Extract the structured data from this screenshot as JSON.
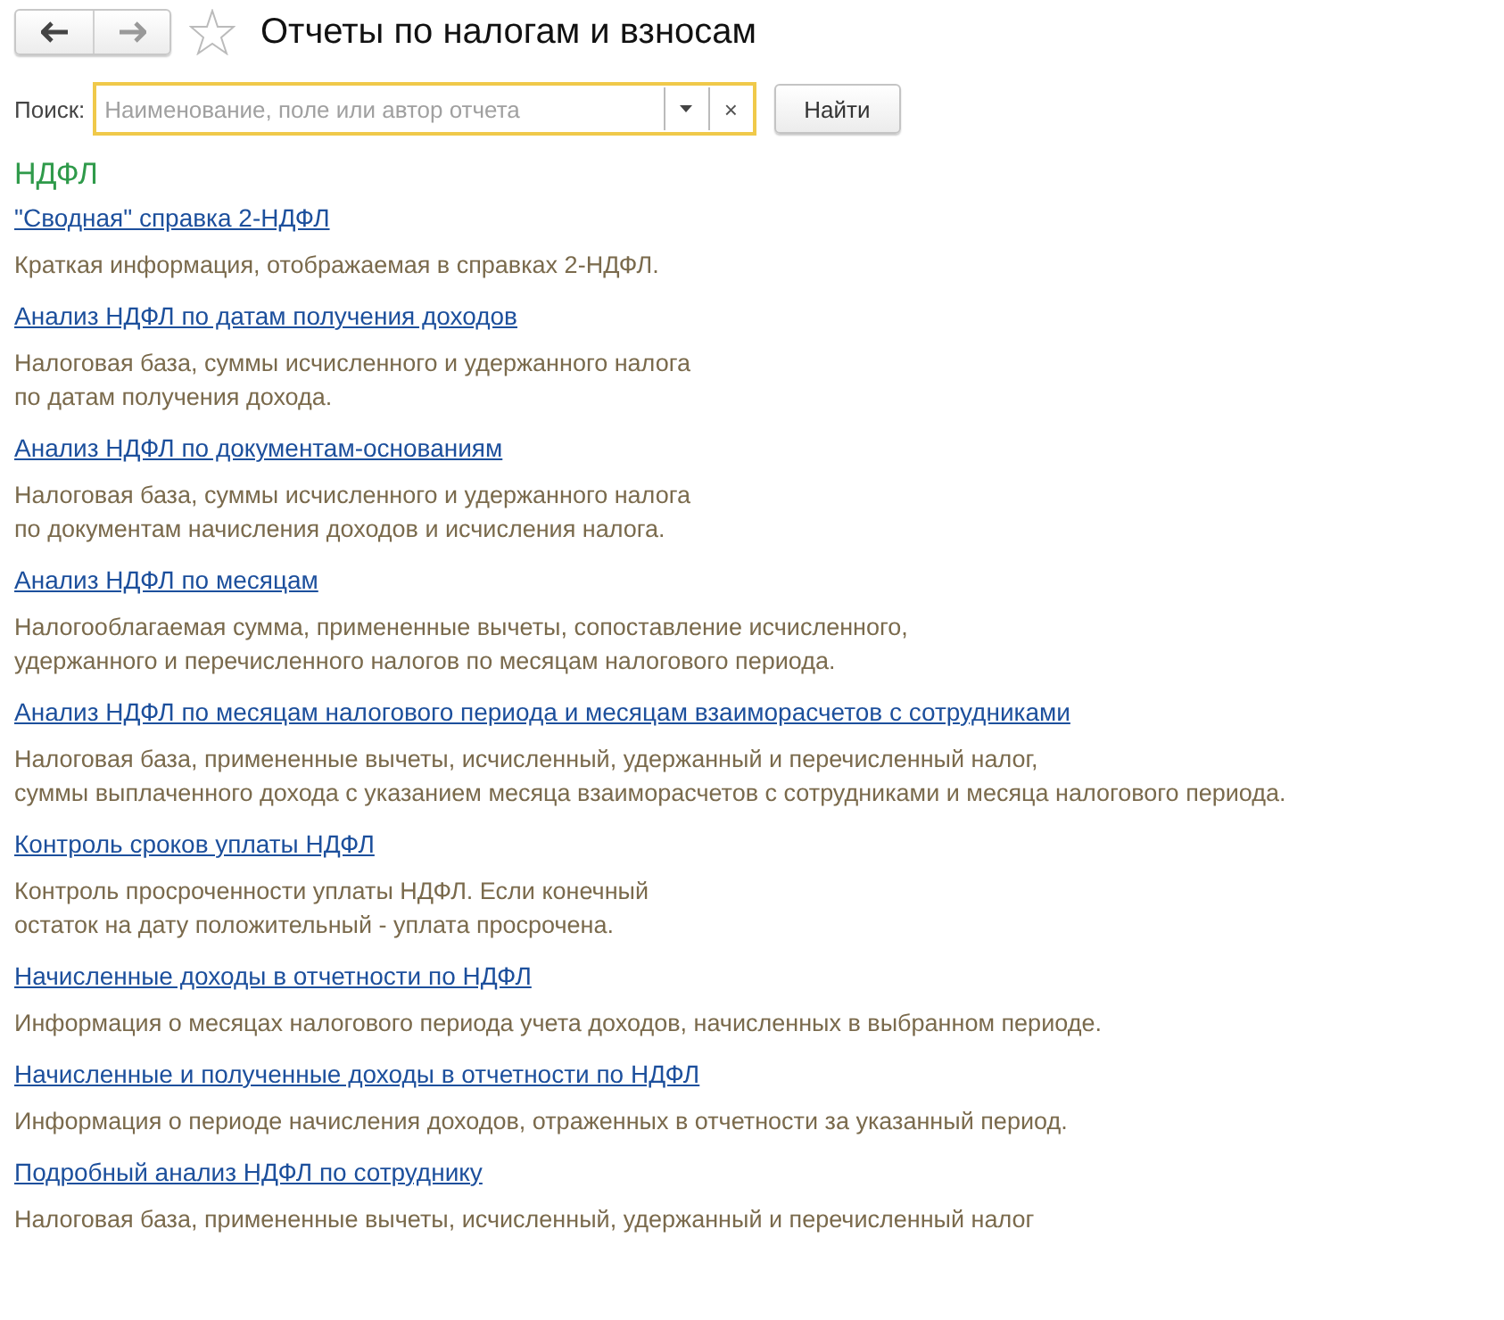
{
  "window": {
    "title": "Отчеты по налогам и взносам",
    "favorite": false
  },
  "search": {
    "label": "Поиск:",
    "placeholder": "Наименование, поле или автор отчета",
    "clear": "×",
    "button": "Найти"
  },
  "section": {
    "title": "НДФЛ"
  },
  "reports": [
    {
      "title": "\"Сводная\" справка 2-НДФЛ",
      "description": "Краткая информация, отображаемая в справках 2-НДФЛ."
    },
    {
      "title": "Анализ НДФЛ по датам получения доходов",
      "description": "Налоговая база, суммы исчисленного и удержанного налога\nпо датам получения дохода."
    },
    {
      "title": "Анализ НДФЛ по документам-основаниям",
      "description": "Налоговая база, суммы исчисленного и удержанного налога\nпо документам начисления доходов и исчисления налога."
    },
    {
      "title": "Анализ НДФЛ по месяцам",
      "description": "Налогооблагаемая сумма, примененные вычеты, сопоставление исчисленного,\nудержанного и перечисленного налогов по месяцам налогового периода."
    },
    {
      "title": "Анализ НДФЛ по месяцам налогового периода и месяцам взаиморасчетов с сотрудниками",
      "description": "Налоговая база, примененные вычеты, исчисленный, удержанный и перечисленный налог,\nсуммы выплаченного дохода с указанием месяца взаиморасчетов с сотрудниками и месяца налогового периода."
    },
    {
      "title": "Контроль сроков уплаты НДФЛ",
      "description": "Контроль просроченности уплаты НДФЛ. Если конечный\nостаток на дату положительный - уплата просрочена."
    },
    {
      "title": "Начисленные доходы в отчетности по НДФЛ",
      "description": "Информация о месяцах налогового периода учета доходов, начисленных в выбранном периоде."
    },
    {
      "title": "Начисленные и полученные доходы в отчетности по НДФЛ",
      "description": "Информация о периоде начисления доходов, отраженных в отчетности за указанный период."
    },
    {
      "title": "Подробный анализ НДФЛ по сотруднику",
      "description": "Налоговая база, примененные вычеты, исчисленный, удержанный и перечисленный налог"
    }
  ]
}
